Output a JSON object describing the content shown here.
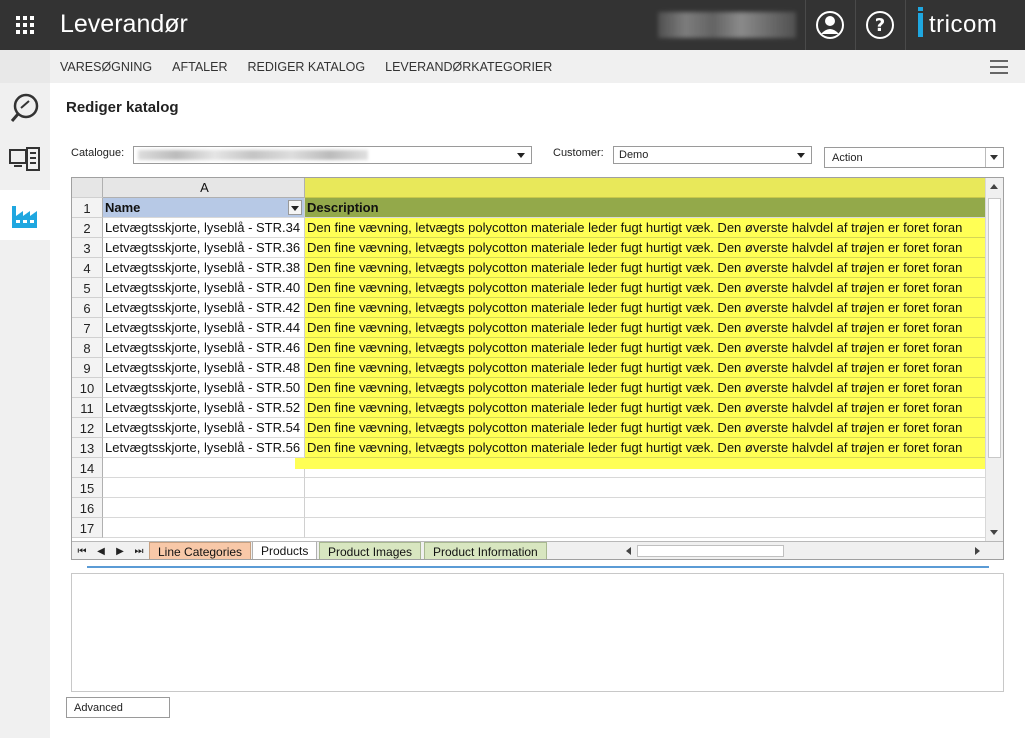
{
  "header": {
    "title": "Leverandør",
    "brand": "tricom",
    "icons": [
      "apps-grid-icon",
      "user-icon",
      "help-icon"
    ],
    "help_glyph": "?"
  },
  "nav": {
    "items": [
      "VARESØGNING",
      "AFTALER",
      "REDIGER KATALOG",
      "LEVERANDØRKATEGORIER"
    ]
  },
  "sidebar": {
    "items": [
      "search-icon",
      "catalog-list-icon",
      "factory-icon"
    ],
    "active": "factory-icon"
  },
  "page": {
    "title": "Rediger katalog",
    "catalogue_label": "Catalogue:",
    "customer_label": "Customer:",
    "customer_value": "Demo",
    "action_label": "Action",
    "advanced_label": "Advanced"
  },
  "sheet": {
    "column_header": "A",
    "headers": {
      "name": "Name",
      "description": "Description"
    },
    "row_numbers": [
      "1",
      "2",
      "3",
      "4",
      "5",
      "6",
      "7",
      "8",
      "9",
      "10",
      "11",
      "12",
      "13",
      "14",
      "15",
      "16",
      "17"
    ],
    "rows": [
      {
        "name": "Letvægtsskjorte, lyseblå - STR.34",
        "description": "Den fine vævning, letvægts polycotton materiale leder fugt hurtigt væk. Den øverste halvdel af trøjen er foret foran"
      },
      {
        "name": "Letvægtsskjorte, lyseblå - STR.36",
        "description": "Den fine vævning, letvægts polycotton materiale leder fugt hurtigt væk. Den øverste halvdel af trøjen er foret foran"
      },
      {
        "name": "Letvægtsskjorte, lyseblå - STR.38",
        "description": "Den fine vævning, letvægts polycotton materiale leder fugt hurtigt væk. Den øverste halvdel af trøjen er foret foran"
      },
      {
        "name": "Letvægtsskjorte, lyseblå - STR.40",
        "description": "Den fine vævning, letvægts polycotton materiale leder fugt hurtigt væk. Den øverste halvdel af trøjen er foret foran"
      },
      {
        "name": "Letvægtsskjorte, lyseblå - STR.42",
        "description": "Den fine vævning, letvægts polycotton materiale leder fugt hurtigt væk. Den øverste halvdel af trøjen er foret foran"
      },
      {
        "name": "Letvægtsskjorte, lyseblå - STR.44",
        "description": "Den fine vævning, letvægts polycotton materiale leder fugt hurtigt væk. Den øverste halvdel af trøjen er foret foran"
      },
      {
        "name": "Letvægtsskjorte, lyseblå - STR.46",
        "description": "Den fine vævning, letvægts polycotton materiale leder fugt hurtigt væk. Den øverste halvdel af trøjen er foret foran"
      },
      {
        "name": "Letvægtsskjorte, lyseblå - STR.48",
        "description": "Den fine vævning, letvægts polycotton materiale leder fugt hurtigt væk. Den øverste halvdel af trøjen er foret foran"
      },
      {
        "name": "Letvægtsskjorte, lyseblå - STR.50",
        "description": "Den fine vævning, letvægts polycotton materiale leder fugt hurtigt væk. Den øverste halvdel af trøjen er foret foran"
      },
      {
        "name": "Letvægtsskjorte, lyseblå - STR.52",
        "description": "Den fine vævning, letvægts polycotton materiale leder fugt hurtigt væk. Den øverste halvdel af trøjen er foret foran"
      },
      {
        "name": "Letvægtsskjorte, lyseblå - STR.54",
        "description": "Den fine vævning, letvægts polycotton materiale leder fugt hurtigt væk. Den øverste halvdel af trøjen er foret foran"
      },
      {
        "name": "Letvægtsskjorte, lyseblå - STR.56",
        "description": "Den fine vævning, letvægts polycotton materiale leder fugt hurtigt væk. Den øverste halvdel af trøjen er foret foran"
      }
    ],
    "tabs": [
      "Line Categories",
      "Products",
      "Product Images",
      "Product Information"
    ],
    "active_tab": "Products",
    "nav_arrows": [
      "⏮",
      "◀",
      "▶",
      "⏭"
    ]
  },
  "colors": {
    "topbar": "#333333",
    "brand_accent": "#1fa7e0",
    "highlight_yellow": "#ffff55",
    "header_green": "#93a94a",
    "name_header_blue": "#b7c9e6"
  }
}
